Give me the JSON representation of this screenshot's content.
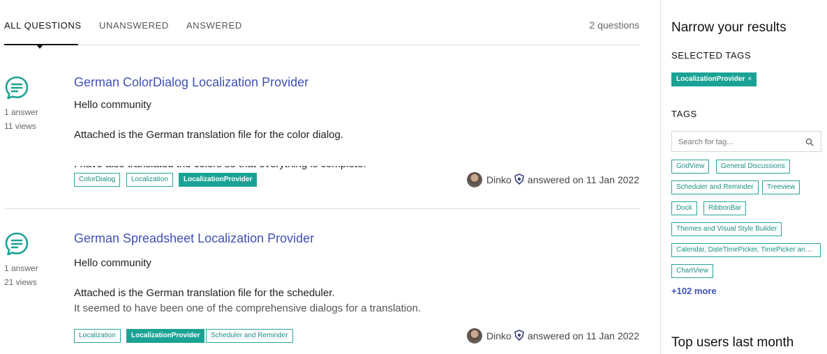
{
  "tabs": {
    "all": "ALL QUESTIONS",
    "unanswered": "UNANSWERED",
    "answered": "ANSWERED",
    "count": "2 questions"
  },
  "questions": [
    {
      "title": "German ColorDialog Localization Provider",
      "answers": "1 answer",
      "views": "11 views",
      "body1": "Hello community",
      "body2": "Attached is the German translation file for the color dialog.",
      "body3": "I have also translated the colors so that everything is complete.",
      "tags": [
        "ColorDialog",
        "Localization",
        "LocalizationProvider"
      ],
      "user": "Dinko",
      "answered": "answered on 11 Jan 2022"
    },
    {
      "title": "German Spreadsheet Localization Provider",
      "answers": "1 answer",
      "views": "21 views",
      "body1": "Hello community",
      "body2": "Attached is the German translation file for the scheduler.",
      "body3": "It seemed to have been one of the comprehensive dialogs for a translation.",
      "tags": [
        "Localization",
        "LocalizationProvider",
        "Scheduler and Reminder"
      ],
      "user": "Dinko",
      "answered": "answered on 11 Jan 2022"
    }
  ],
  "sidebar": {
    "title": "Narrow your results",
    "selected_heading": "SELECTED TAGS",
    "selected_tag": "LocalizationProvider",
    "remove_symbol": "×",
    "tags_heading": "TAGS",
    "search_placeholder": "Search for tag...",
    "tags": [
      "GridView",
      "General Discussions",
      "Scheduler and Reminder",
      "Treeview",
      "Dock",
      "RibbonBar",
      "Themes and Visual Style Builder",
      "Calendar, DateTimePicker, TimePicker and C...",
      "ChartView"
    ],
    "more": "+102 more",
    "top_users": "Top users last month"
  },
  "colors": {
    "accent_teal": "#1aa394",
    "link_blue": "#3f51b5"
  },
  "icons": {
    "question": "chat-bubble-icon",
    "search": "search-icon",
    "badge": "shield-badge-icon"
  }
}
